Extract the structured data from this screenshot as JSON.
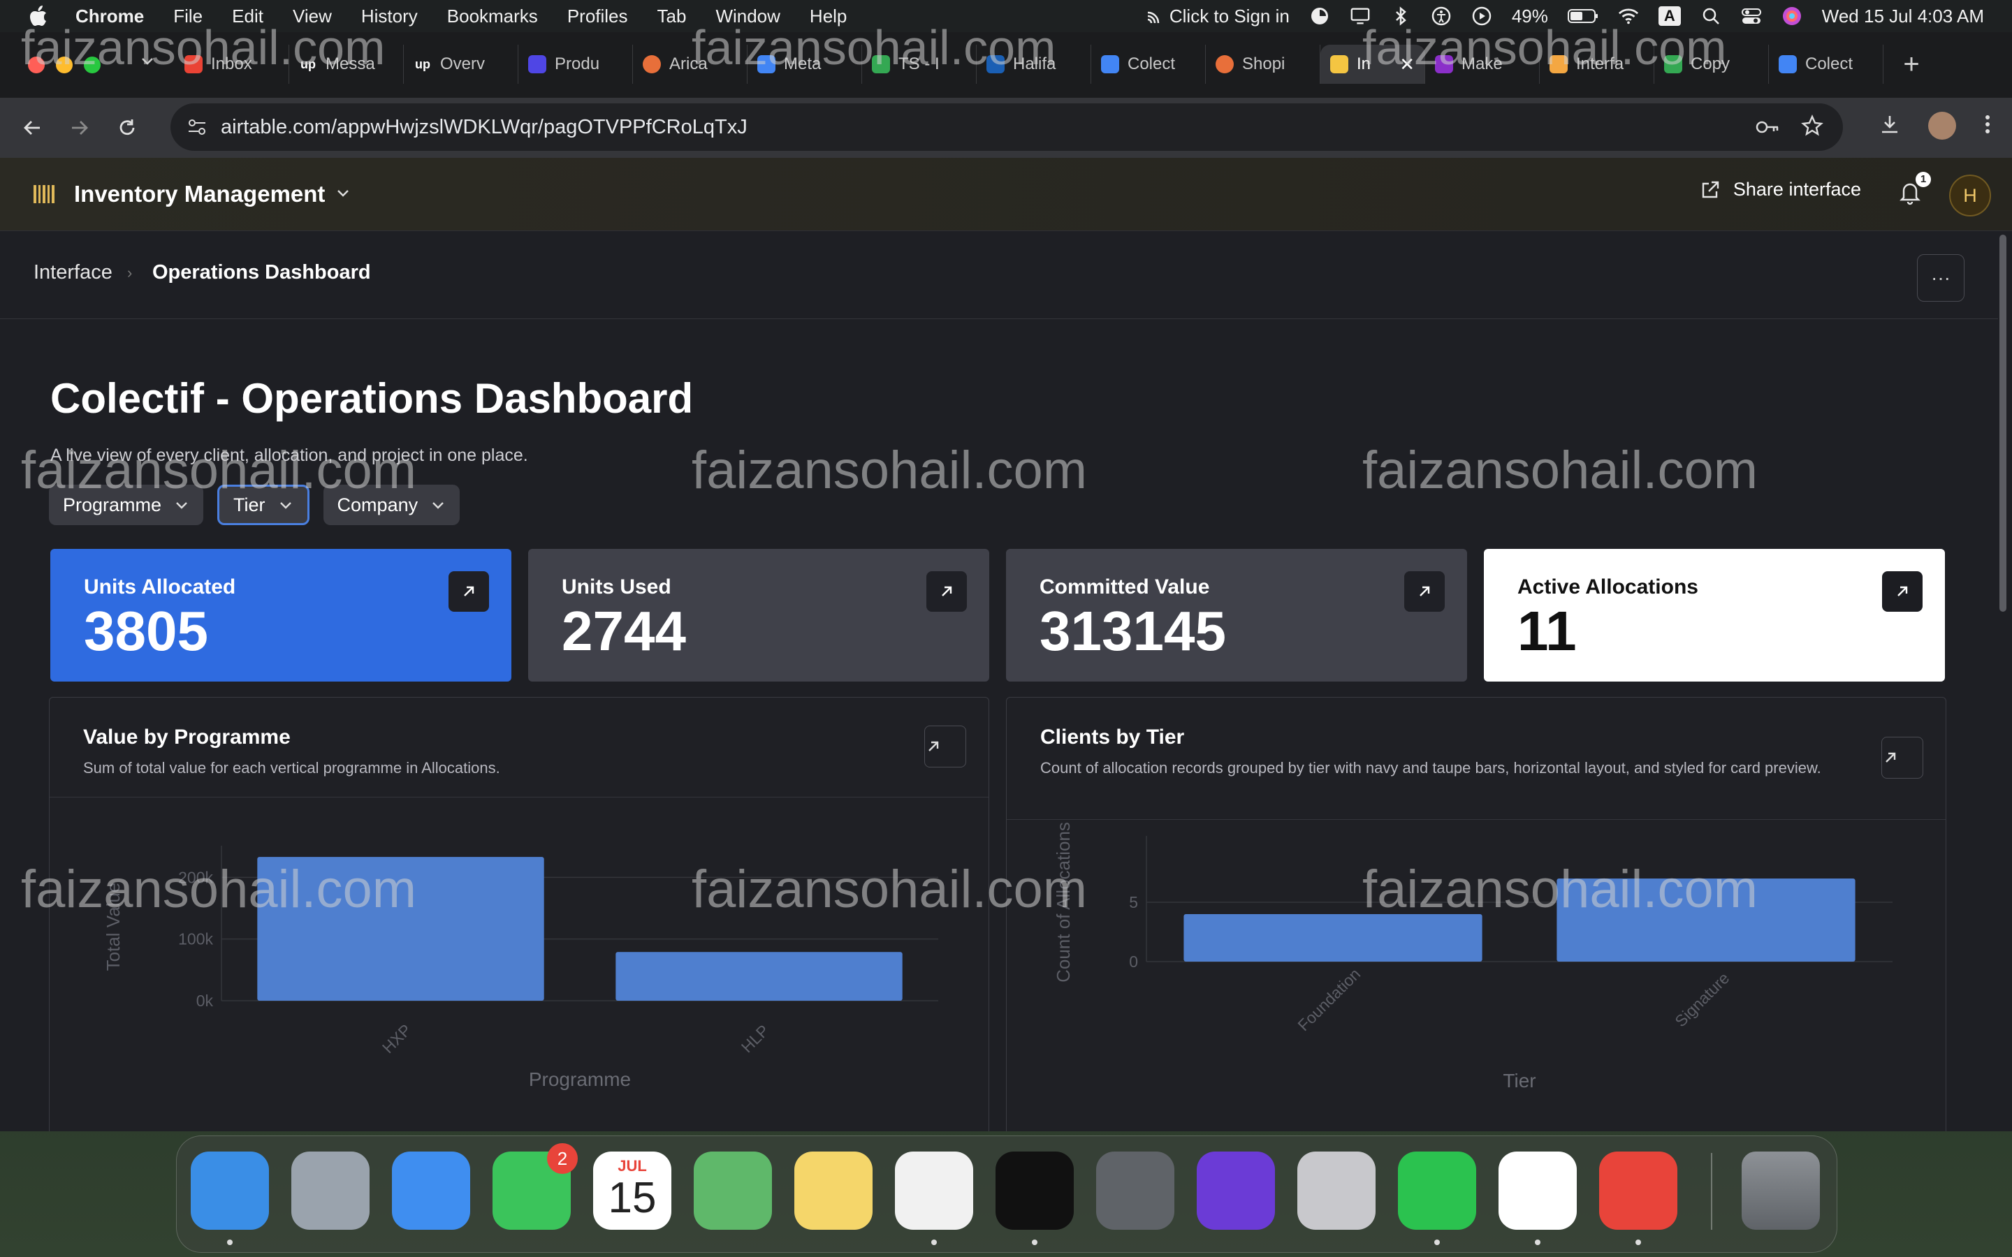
{
  "menubar": {
    "app": "Chrome",
    "items": [
      "File",
      "Edit",
      "View",
      "History",
      "Bookmarks",
      "Profiles",
      "Tab",
      "Window",
      "Help"
    ],
    "sign_in": "Click to Sign in",
    "battery": "49%",
    "input_source": "A",
    "datetime": "Wed 15 Jul  4:03 AM"
  },
  "tabs": [
    {
      "label": "Inbox",
      "color": "#ea4335"
    },
    {
      "label": "Messa",
      "color": "#1b1c1e"
    },
    {
      "label": "Overv",
      "color": "#1b1c1e"
    },
    {
      "label": "Produ",
      "color": "#4f46e5"
    },
    {
      "label": "Arica",
      "color": "#e86f3a"
    },
    {
      "label": "Meta",
      "color": "#4285f4"
    },
    {
      "label": "TS - I",
      "color": "#34a853"
    },
    {
      "label": "Halifa",
      "color": "#1a5fb4"
    },
    {
      "label": "Colect",
      "color": "#4285f4"
    },
    {
      "label": "Shopi",
      "color": "#e86f3a"
    },
    {
      "label": "In",
      "color": "#f4c542"
    },
    {
      "label": "Make",
      "color": "#8b2fc9"
    },
    {
      "label": "Interfa",
      "color": "#f4a742"
    },
    {
      "label": "Copy",
      "color": "#34a853"
    },
    {
      "label": "Colect",
      "color": "#4285f4"
    }
  ],
  "browser": {
    "url": "airtable.com/appwHwjzslWDKLWqr/pagOTVPPfCRoLqTxJ"
  },
  "header": {
    "base_name": "Inventory Management",
    "share_label": "Share interface",
    "notification_count": "1",
    "avatar_initial": "H"
  },
  "breadcrumb": {
    "root": "Interface",
    "current": "Operations Dashboard",
    "more": "···"
  },
  "page": {
    "title": "Colectif - Operations Dashboard",
    "subtitle": "A live view of every client, allocation, and project in one place."
  },
  "filters": [
    "Programme",
    "Tier",
    "Company"
  ],
  "kpis": [
    {
      "label": "Units Allocated",
      "value": "3805",
      "style": "blue"
    },
    {
      "label": "Units Used",
      "value": "2744",
      "style": "gray"
    },
    {
      "label": "Committed Value",
      "value": "313145",
      "style": "gray"
    },
    {
      "label": "Active Allocations",
      "value": "11",
      "style": "white"
    }
  ],
  "charts": {
    "programme": {
      "title": "Value by Programme",
      "description": "Sum of total value for each vertical programme in Allocations."
    },
    "tier": {
      "title": "Clients by Tier",
      "description": "Count of allocation records grouped by tier with navy and taupe bars, horizontal layout, and styled for card preview."
    }
  },
  "chart_data": [
    {
      "type": "bar",
      "title": "Value by Programme",
      "categories": [
        "HXP",
        "HLP"
      ],
      "values": [
        233000,
        79000
      ],
      "xlabel": "Programme",
      "ylabel": "Total Value",
      "yticks": [
        "0k",
        "100k",
        "200k"
      ],
      "ylim": [
        0,
        240000
      ],
      "grid": true,
      "color": "#4f7fcf"
    },
    {
      "type": "bar",
      "title": "Clients by Tier",
      "categories": [
        "Foundation",
        "Signature"
      ],
      "values": [
        4,
        7
      ],
      "xlabel": "Tier",
      "ylabel": "Count of Allocations",
      "yticks": [
        "0",
        "5"
      ],
      "ylim": [
        0,
        10
      ],
      "grid": true,
      "color": "#4f7fcf"
    }
  ],
  "watermark": "faizansohail.com",
  "dock": {
    "calendar_month": "JUL",
    "calendar_day": "15",
    "messages_badge": "2",
    "apps": [
      {
        "name": "Finder",
        "color": "#3a8ee6"
      },
      {
        "name": "Launchpad",
        "color": "#9aa3ad"
      },
      {
        "name": "Mail",
        "color": "#3f8ef0"
      },
      {
        "name": "Messages",
        "color": "#3bc45b"
      },
      {
        "name": "Calendar",
        "color": "#ffffff"
      },
      {
        "name": "Maps",
        "color": "#5fb86a"
      },
      {
        "name": "Notes",
        "color": "#f5d66a"
      },
      {
        "name": "Chrome",
        "color": "#f1f1f1"
      },
      {
        "name": "Spotify",
        "color": "#111111"
      },
      {
        "name": "Calculator",
        "color": "#5f6368"
      },
      {
        "name": "Firefox",
        "color": "#6b3bd6"
      },
      {
        "name": "iPhone Mirroring",
        "color": "#c8c8cc"
      },
      {
        "name": "WhatsApp",
        "color": "#2bc24f"
      },
      {
        "name": "Slack",
        "color": "#ffffff"
      },
      {
        "name": "AnyDesk",
        "color": "#e8443a"
      }
    ]
  }
}
